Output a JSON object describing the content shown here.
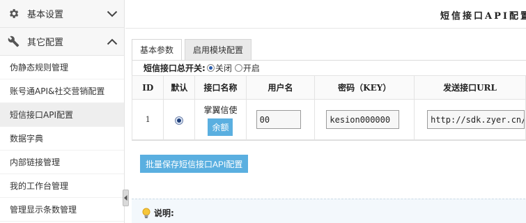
{
  "sidebar": {
    "groups": [
      {
        "label": "基本设置",
        "icon": "gear-icon",
        "state": "collapsed"
      },
      {
        "label": "其它配置",
        "icon": "wrench-icon",
        "state": "expanded"
      }
    ],
    "items": [
      {
        "label": "伪静态规则管理"
      },
      {
        "label": "账号通API&社交营销配置"
      },
      {
        "label": "短信接口API配置",
        "active": true
      },
      {
        "label": "数据字典"
      },
      {
        "label": "内部链接管理"
      },
      {
        "label": "我的工作台管理"
      },
      {
        "label": "管理显示条数管理"
      }
    ]
  },
  "header": {
    "title": "短信接口API配置"
  },
  "tabs": [
    {
      "label": "基本参数",
      "active": true
    },
    {
      "label": "启用模块配置",
      "active": false
    }
  ],
  "sms_switch": {
    "label": "短信接口总开关:",
    "options": [
      {
        "label": "关闭",
        "checked": true
      },
      {
        "label": "开启",
        "checked": false
      }
    ]
  },
  "table": {
    "headers": [
      "ID",
      "默认",
      "接口名称",
      "用户名",
      "密码（KEY）",
      "发送接口URL"
    ],
    "rows": [
      {
        "id": "1",
        "default": true,
        "name": "掌翼信使",
        "balance_button": "余额",
        "username": "00",
        "password": "kesion000000",
        "url": "http://sdk.zyer.cn/"
      }
    ]
  },
  "save_button": "批量保存短信接口API配置",
  "note": {
    "title": "说明:"
  },
  "colors": {
    "accent_button": "#5aafe0",
    "active_item_bg": "#eeeeee"
  }
}
